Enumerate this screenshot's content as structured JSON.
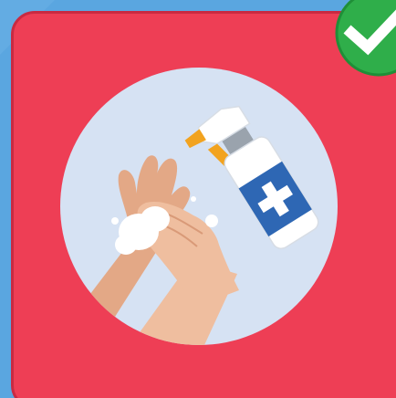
{
  "card": {
    "state": "correct",
    "illustration": "hand-sanitizer-hands-washing",
    "colors": {
      "background": "#5aa6e0",
      "card_fill": "#ee3e55",
      "card_border": "#c92a42",
      "circle": "#d6e2f3",
      "skin": "#e9b594",
      "bottle_label": "#2e67b4",
      "bottle_white": "#ffffff",
      "nozzle_orange": "#f2a31f",
      "check_green": "#2fae4a"
    }
  },
  "badge": {
    "icon": "check-icon"
  }
}
